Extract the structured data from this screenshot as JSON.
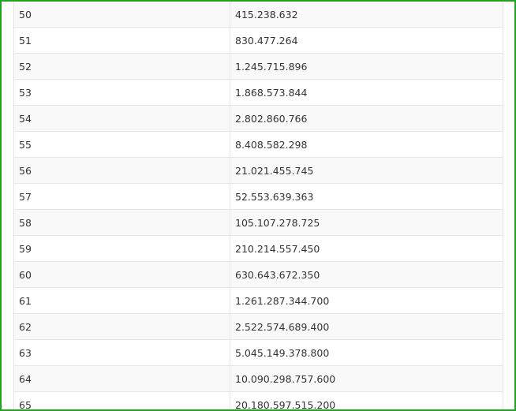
{
  "table": {
    "rows": [
      {
        "level": "50",
        "value": "415.238.632"
      },
      {
        "level": "51",
        "value": "830.477.264"
      },
      {
        "level": "52",
        "value": "1.245.715.896"
      },
      {
        "level": "53",
        "value": "1.868.573.844"
      },
      {
        "level": "54",
        "value": "2.802.860.766"
      },
      {
        "level": "55",
        "value": "8.408.582.298"
      },
      {
        "level": "56",
        "value": "21.021.455.745"
      },
      {
        "level": "57",
        "value": "52.553.639.363"
      },
      {
        "level": "58",
        "value": "105.107.278.725"
      },
      {
        "level": "59",
        "value": "210.214.557.450"
      },
      {
        "level": "60",
        "value": "630.643.672.350"
      },
      {
        "level": "61",
        "value": "1.261.287.344.700"
      },
      {
        "level": "62",
        "value": "2.522.574.689.400"
      },
      {
        "level": "63",
        "value": "5.045.149.378.800"
      },
      {
        "level": "64",
        "value": "10.090.298.757.600"
      },
      {
        "level": "65",
        "value": "20.180.597.515.200"
      }
    ]
  },
  "colors": {
    "frame_border": "#21a321",
    "row_odd": "#f9f9f9",
    "row_even": "#ffffff",
    "grid_line": "#e6e6e6",
    "text": "#333333"
  }
}
